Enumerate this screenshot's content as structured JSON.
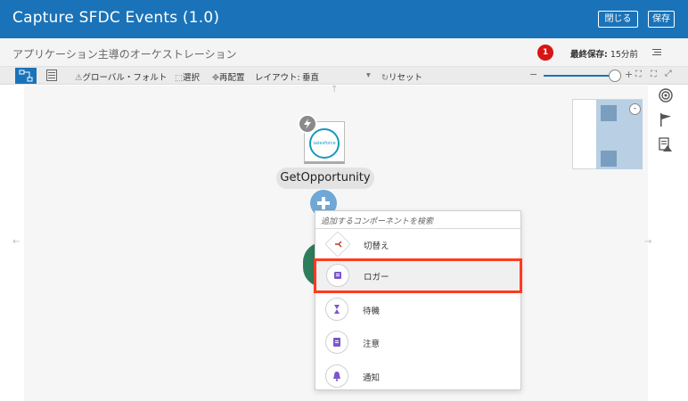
{
  "app": {
    "title": "Capture SFDC Events (1.0)",
    "close_label": "閉じる",
    "save_label": "保存"
  },
  "subheader": {
    "title": "アプリケーション主導のオーケストレーション",
    "notification_count": "1",
    "last_saved_label": "最終保存:",
    "last_saved_value": "15分前"
  },
  "toolbar": {
    "global_fault": "グローバル・フォルト",
    "select": "選択",
    "reposition": "再配置",
    "layout_label": "レイアウト:",
    "layout_value": "垂直",
    "reset": "リセット",
    "zoom_minus": "−",
    "zoom_plus": "+"
  },
  "canvas": {
    "node_label": "GetOpportunity",
    "sf_logo_text": "salesforce"
  },
  "popup": {
    "search_placeholder": "追加するコンポーネントを検索",
    "items": [
      {
        "label": "切替え",
        "icon": "switch-icon",
        "color": "#c0392b"
      },
      {
        "label": "ロガー",
        "icon": "logger-icon",
        "color": "#7b57c9"
      },
      {
        "label": "待機",
        "icon": "wait-icon",
        "color": "#7b57c9"
      },
      {
        "label": "注意",
        "icon": "note-icon",
        "color": "#7b57c9"
      },
      {
        "label": "通知",
        "icon": "notification-icon",
        "color": "#7b57c9"
      }
    ]
  },
  "colors": {
    "brand": "#1a73b8",
    "highlight": "#ff3b1f",
    "badge": "#d81515"
  }
}
